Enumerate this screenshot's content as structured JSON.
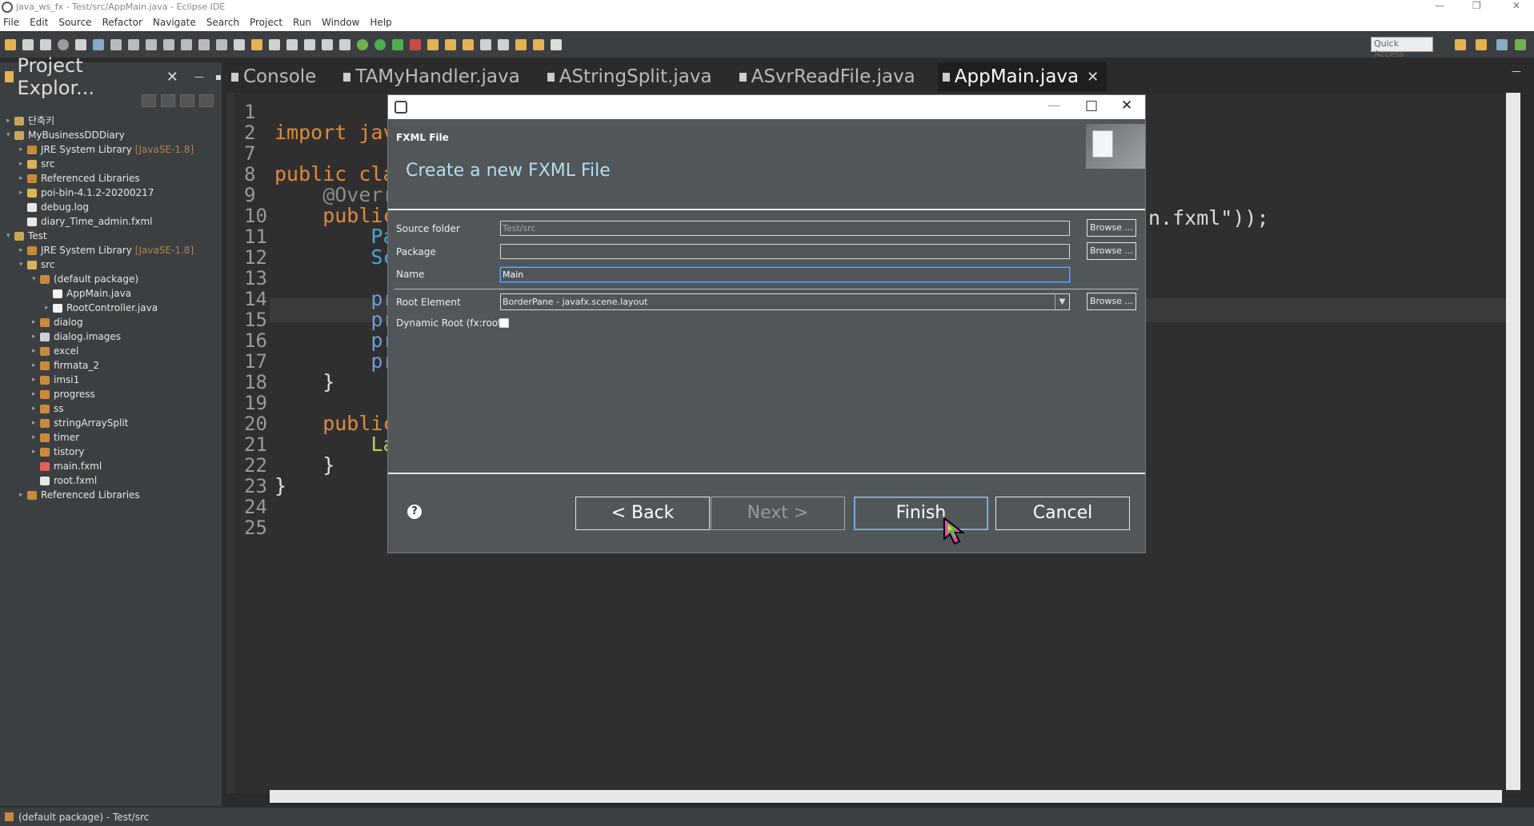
{
  "window": {
    "title": "java_ws_fx - Test/src/AppMain.java - Eclipse IDE"
  },
  "menu": [
    "File",
    "Edit",
    "Source",
    "Refactor",
    "Navigate",
    "Search",
    "Project",
    "Run",
    "Window",
    "Help"
  ],
  "toolbar": {
    "quick_access": "Quick Access"
  },
  "explorer": {
    "title": "Project Explor...",
    "items": [
      {
        "label": "단축키",
        "depth": 0,
        "twisty": "▸",
        "icon_color": "#c9a65a"
      },
      {
        "label": "MyBusinessDDDiary",
        "depth": 0,
        "twisty": "▾",
        "icon_color": "#c9a65a"
      },
      {
        "label": "JRE System Library",
        "sub": "[JavaSE-1.8]",
        "depth": 1,
        "twisty": "▸",
        "icon_color": "#c88b3a"
      },
      {
        "label": "src",
        "depth": 1,
        "twisty": "▸",
        "icon_color": "#d8b25c"
      },
      {
        "label": "Referenced Libraries",
        "depth": 1,
        "twisty": "▸",
        "icon_color": "#c88b3a"
      },
      {
        "label": "poi-bin-4.1.2-20200217",
        "depth": 1,
        "twisty": "▸",
        "icon_color": "#e0b650"
      },
      {
        "label": "debug.log",
        "depth": 1,
        "twisty": "",
        "icon_color": "#e8e8e8"
      },
      {
        "label": "diary_Time_admin.fxml",
        "depth": 1,
        "twisty": "",
        "icon_color": "#e8e8e8"
      },
      {
        "label": "Test",
        "depth": 0,
        "twisty": "▾",
        "icon_color": "#c9a65a"
      },
      {
        "label": "JRE System Library",
        "sub": "[JavaSE-1.8]",
        "depth": 1,
        "twisty": "▸",
        "icon_color": "#c88b3a"
      },
      {
        "label": "src",
        "depth": 1,
        "twisty": "▾",
        "icon_color": "#d8b25c"
      },
      {
        "label": "(default package)",
        "depth": 2,
        "twisty": "▾",
        "icon_color": "#c98a3e"
      },
      {
        "label": "AppMain.java",
        "depth": 3,
        "twisty": "",
        "icon_color": "#f2f2f2"
      },
      {
        "label": "RootController.java",
        "depth": 3,
        "twisty": "▸",
        "icon_color": "#f2f2f2"
      },
      {
        "label": "dialog",
        "depth": 2,
        "twisty": "▸",
        "icon_color": "#c98a3e"
      },
      {
        "label": "dialog.images",
        "depth": 2,
        "twisty": "▸",
        "icon_color": "#d0d0d0"
      },
      {
        "label": "excel",
        "depth": 2,
        "twisty": "▸",
        "icon_color": "#c98a3e"
      },
      {
        "label": "firmata_2",
        "depth": 2,
        "twisty": "▸",
        "icon_color": "#c98a3e"
      },
      {
        "label": "imsi1",
        "depth": 2,
        "twisty": "▸",
        "icon_color": "#c98a3e"
      },
      {
        "label": "progress",
        "depth": 2,
        "twisty": "▸",
        "icon_color": "#c98a3e"
      },
      {
        "label": "ss",
        "depth": 2,
        "twisty": "▸",
        "icon_color": "#c98a3e"
      },
      {
        "label": "stringArraySplit",
        "depth": 2,
        "twisty": "▸",
        "icon_color": "#c98a3e"
      },
      {
        "label": "timer",
        "depth": 2,
        "twisty": "▸",
        "icon_color": "#c98a3e"
      },
      {
        "label": "tistory",
        "depth": 2,
        "twisty": "▸",
        "icon_color": "#c98a3e"
      },
      {
        "label": "main.fxml",
        "depth": 2,
        "twisty": "",
        "icon_color": "#e06060"
      },
      {
        "label": "root.fxml",
        "depth": 2,
        "twisty": "",
        "icon_color": "#e8e8e8"
      },
      {
        "label": "Referenced Libraries",
        "depth": 1,
        "twisty": "▸",
        "icon_color": "#c88b3a"
      }
    ]
  },
  "editor": {
    "tabs": [
      {
        "label": "Console",
        "active": false
      },
      {
        "label": "TAMyHandler.java",
        "active": false
      },
      {
        "label": "AStringSplit.java",
        "active": false
      },
      {
        "label": "ASvrReadFile.java",
        "active": false
      },
      {
        "label": "AppMain.java",
        "active": true
      }
    ],
    "lines": [
      {
        "no": "1",
        "code": ""
      },
      {
        "no": "2",
        "code": "import jav"
      },
      {
        "no": "7",
        "code": ""
      },
      {
        "no": "8",
        "code": "public cla"
      },
      {
        "no": "9",
        "code": "    @Overr"
      },
      {
        "no": "10",
        "code": "    public"
      },
      {
        "no": "11",
        "code": "        Pa"
      },
      {
        "no": "12",
        "code": "        Sc"
      },
      {
        "no": "13",
        "code": ""
      },
      {
        "no": "14",
        "code": "        pr"
      },
      {
        "no": "15",
        "code": "        pr"
      },
      {
        "no": "16",
        "code": "        pr"
      },
      {
        "no": "17",
        "code": "        pr"
      },
      {
        "no": "18",
        "code": "    }"
      },
      {
        "no": "19",
        "code": ""
      },
      {
        "no": "20",
        "code": "    public"
      },
      {
        "no": "21",
        "code": "        La"
      },
      {
        "no": "22",
        "code": "    }"
      },
      {
        "no": "23",
        "code": "}"
      },
      {
        "no": "24",
        "code": ""
      },
      {
        "no": "25",
        "code": ""
      }
    ],
    "right_fragment": "n.fxml\"));"
  },
  "dialog": {
    "section": "FXML File",
    "heading": "Create a new FXML File",
    "labels": {
      "source_folder": "Source folder",
      "package": "Package",
      "name": "Name",
      "root_element": "Root Element",
      "dynamic_root": "Dynamic Root (fx:root)"
    },
    "values": {
      "source_folder": "Test/src",
      "package": "",
      "name": "Main",
      "root_element": "BorderPane - javafx.scene.layout"
    },
    "browse_label": "Browse ...",
    "buttons": {
      "back": "< Back",
      "next": "Next >",
      "finish": "Finish",
      "cancel": "Cancel"
    }
  },
  "status": {
    "text": "(default package) - Test/src"
  }
}
